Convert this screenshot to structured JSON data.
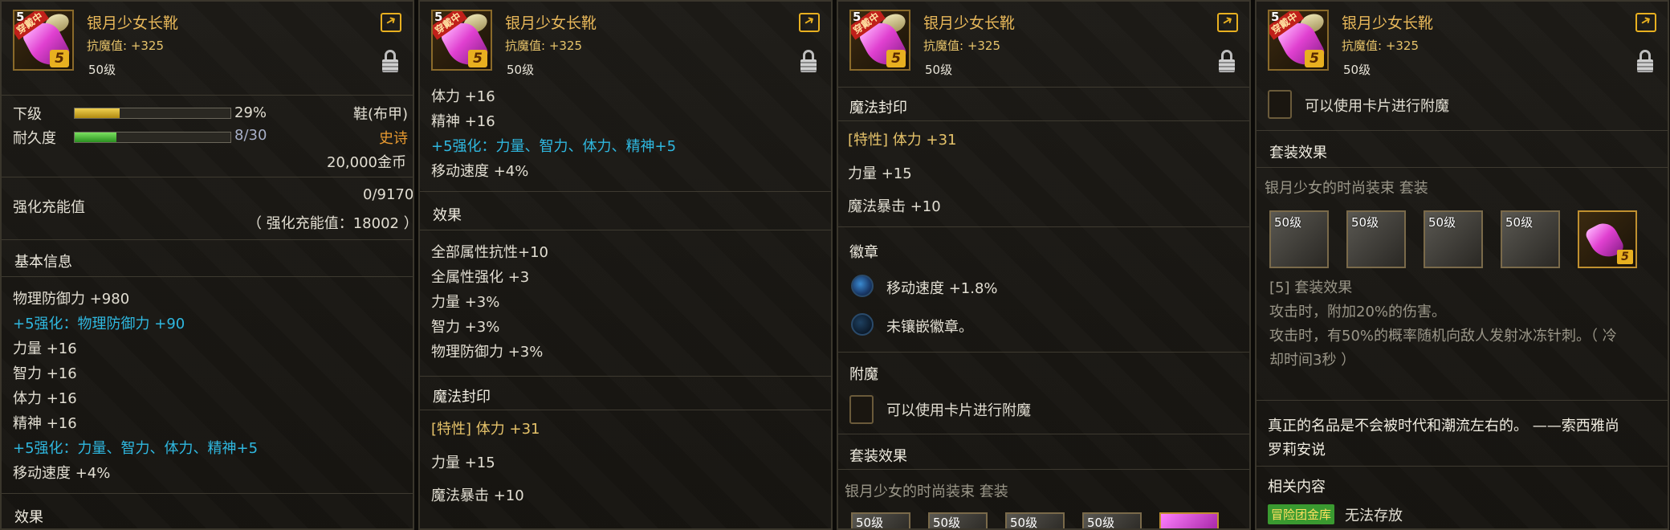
{
  "item": {
    "name": "银月少女长靴",
    "resist": "抗魔值: +325",
    "level": "50级",
    "badge": "穿戴中",
    "lvl_num": "5",
    "grade": "5"
  },
  "p1": {
    "grade_label": "下级",
    "grade_pct": "29%",
    "grade_fill": 0.29,
    "type": "鞋(布甲)",
    "durability_label": "耐久度",
    "durability_value": "8/30",
    "durability_fill": 0.27,
    "rarity": "史诗",
    "price": "20,000金币",
    "charge_label": "强化充能值",
    "charge_value": "0/9170",
    "charge_note": "（ 强化充能值：18002 ）",
    "basic_info": "基本信息",
    "stats": [
      {
        "text": "物理防御力 +980",
        "cls": ""
      },
      {
        "text": "+5强化：物理防御力 +90",
        "cls": "cyan"
      },
      {
        "text": "力量 +16",
        "cls": ""
      },
      {
        "text": "智力 +16",
        "cls": ""
      },
      {
        "text": "体力 +16",
        "cls": ""
      },
      {
        "text": "精神 +16",
        "cls": ""
      },
      {
        "text": "+5强化：力量、智力、体力、精神+5",
        "cls": "cyan"
      },
      {
        "text": "移动速度 +4%",
        "cls": ""
      }
    ],
    "effects": "效果"
  },
  "p2": {
    "stats": [
      {
        "text": "体力 +16",
        "cls": ""
      },
      {
        "text": "精神 +16",
        "cls": ""
      },
      {
        "text": "+5强化：力量、智力、体力、精神+5",
        "cls": "cyan"
      },
      {
        "text": "移动速度 +4%",
        "cls": ""
      }
    ],
    "effects": "效果",
    "effect_list": [
      "全部属性抗性+10",
      "全属性强化 +3",
      "力量 +3%",
      "智力 +3%",
      "物理防御力 +3%"
    ],
    "seal_title": "魔法封印",
    "seal_special": "[特性] 体力 +31",
    "seal_str": "力量 +15",
    "seal_crit": "魔法暴击 +10"
  },
  "p3": {
    "seal_title": "魔法封印",
    "seal_special": "[特性] 体力 +31",
    "seal_str": "力量 +15",
    "seal_crit": "魔法暴击 +10",
    "emblem_title": "徽章",
    "emblem_1": "移动速度 +1.8%",
    "emblem_2": "未镶嵌徽章。",
    "enchant_title": "附魔",
    "enchant_text": "可以使用卡片进行附魔",
    "set_title": "套装效果",
    "set_name": "银月少女的时尚装束 套装",
    "tile_label": "50级"
  },
  "p4": {
    "enchant_text": "可以使用卡片进行附魔",
    "set_title": "套装效果",
    "set_name": "银月少女的时尚装束 套装",
    "tile_label": "50级",
    "set_bonus_title": "[5] 套装效果",
    "set_bonus_1": "攻击时，附加20%的伤害。",
    "set_bonus_2a": "攻击时，有50%的概率随机向敌人发射冰冻针刺。（ 冷",
    "set_bonus_2b": "却时间3秒 ）",
    "quote_a": "真正的名品是不会被时代和潮流左右的。 ——索西雅尚",
    "quote_b": "罗莉安说",
    "related_title": "相关内容",
    "storage_tag": "冒险团金库",
    "storage_text": "无法存放"
  }
}
